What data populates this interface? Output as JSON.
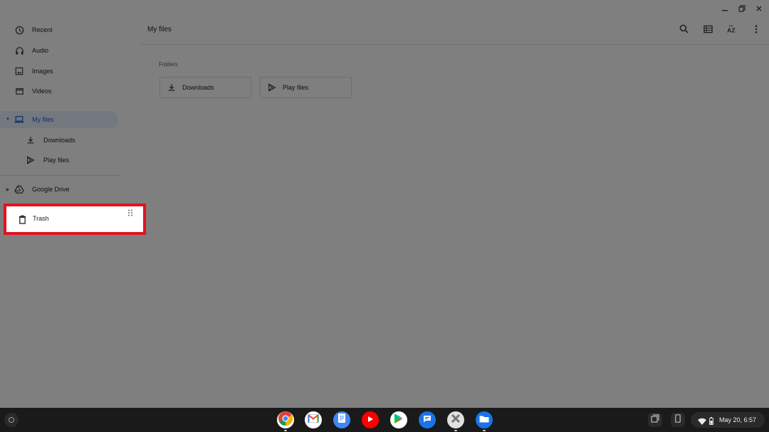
{
  "window": {
    "controls": [
      "minimize",
      "restore",
      "close"
    ]
  },
  "sidebar": {
    "items": [
      {
        "label": "Recent",
        "icon": "clock-icon"
      },
      {
        "label": "Audio",
        "icon": "headphones-icon"
      },
      {
        "label": "Images",
        "icon": "image-icon"
      },
      {
        "label": "Videos",
        "icon": "video-icon"
      },
      {
        "label": "My files",
        "icon": "laptop-icon",
        "selected": true,
        "expanded": true
      },
      {
        "label": "Downloads",
        "icon": "download-icon"
      },
      {
        "label": "Play files",
        "icon": "play-store-icon"
      },
      {
        "label": "Google Drive",
        "icon": "google-drive-icon",
        "expanded": false
      },
      {
        "label": "Trash",
        "icon": "trash-icon",
        "highlighted": true
      }
    ]
  },
  "main": {
    "title": "My files",
    "section_label": "Folders",
    "folders": [
      {
        "label": "Downloads",
        "icon": "download-icon"
      },
      {
        "label": "Play files",
        "icon": "play-store-icon"
      }
    ],
    "toolbar": [
      "search-icon",
      "list-view-icon",
      "sort-az-icon",
      "more-vert-icon"
    ]
  },
  "shelf": {
    "apps": [
      "chrome",
      "gmail",
      "docs",
      "youtube",
      "play-store",
      "messages",
      "settings",
      "files"
    ],
    "status_time": "May 20, 6:57"
  },
  "colors": {
    "selected_bg": "#e8f0fe",
    "selected_text": "#1967d2",
    "highlight_border": "#e3121d",
    "shelf_bg": "#1a1a1a"
  }
}
